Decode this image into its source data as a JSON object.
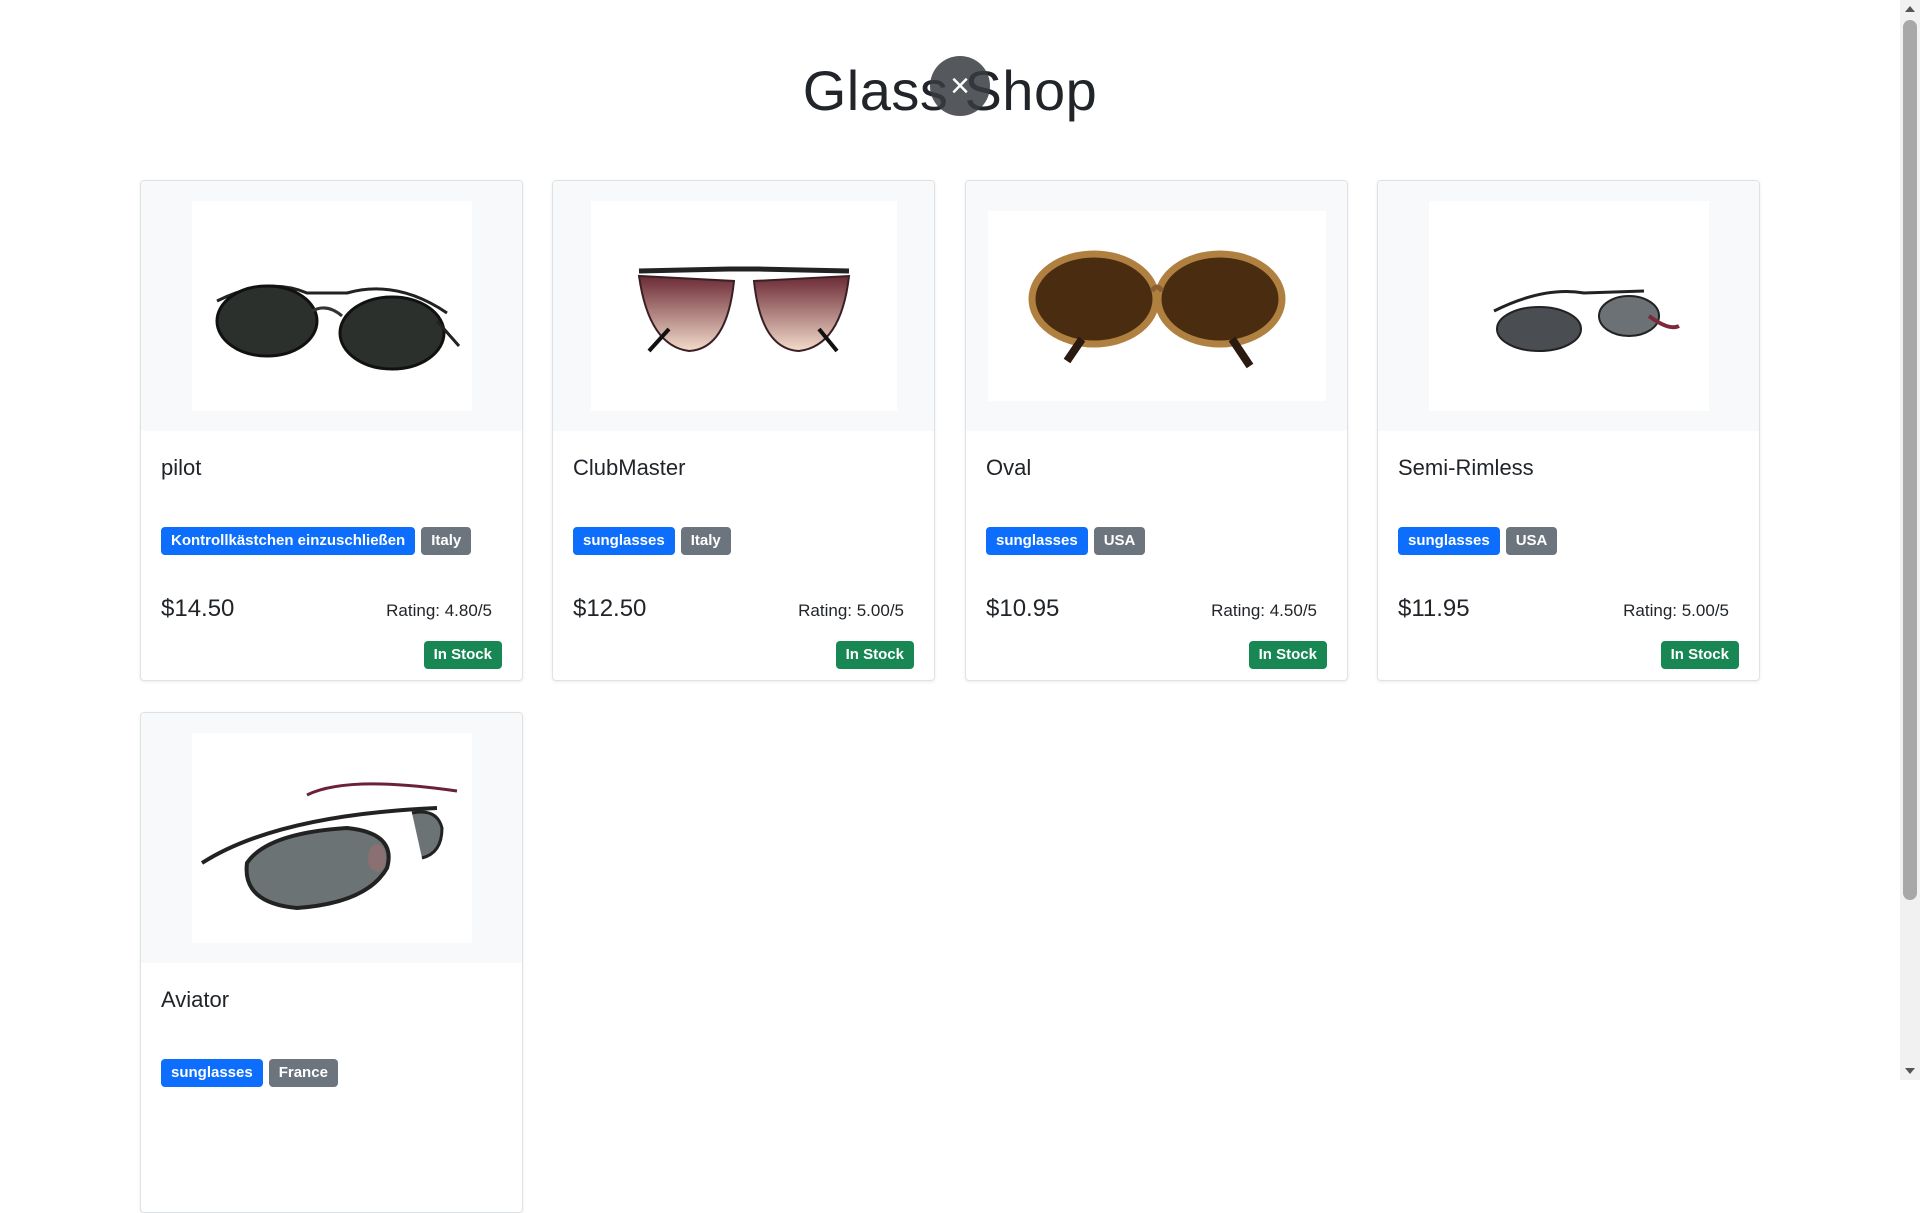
{
  "header": {
    "title": "Glass Shop",
    "close_icon": "×"
  },
  "products": [
    {
      "name": "pilot",
      "type": "Kontrollkästchen einzuschließen",
      "origin": "Italy",
      "price": "$14.50",
      "rating": "Rating: 4.80/5",
      "stock": "In Stock"
    },
    {
      "name": "ClubMaster",
      "type": "sunglasses",
      "origin": "Italy",
      "price": "$12.50",
      "rating": "Rating: 5.00/5",
      "stock": "In Stock"
    },
    {
      "name": "Oval",
      "type": "sunglasses",
      "origin": "USA",
      "price": "$10.95",
      "rating": "Rating: 4.50/5",
      "stock": "In Stock"
    },
    {
      "name": "Semi-Rimless",
      "type": "sunglasses",
      "origin": "USA",
      "price": "$11.95",
      "rating": "Rating: 5.00/5",
      "stock": "In Stock"
    },
    {
      "name": "Aviator",
      "type": "sunglasses",
      "origin": "France",
      "price": "",
      "rating": "",
      "stock": ""
    }
  ],
  "colors": {
    "type_badge": "#0d6efd",
    "origin_badge": "#6c757d",
    "stock_badge": "#198754"
  }
}
